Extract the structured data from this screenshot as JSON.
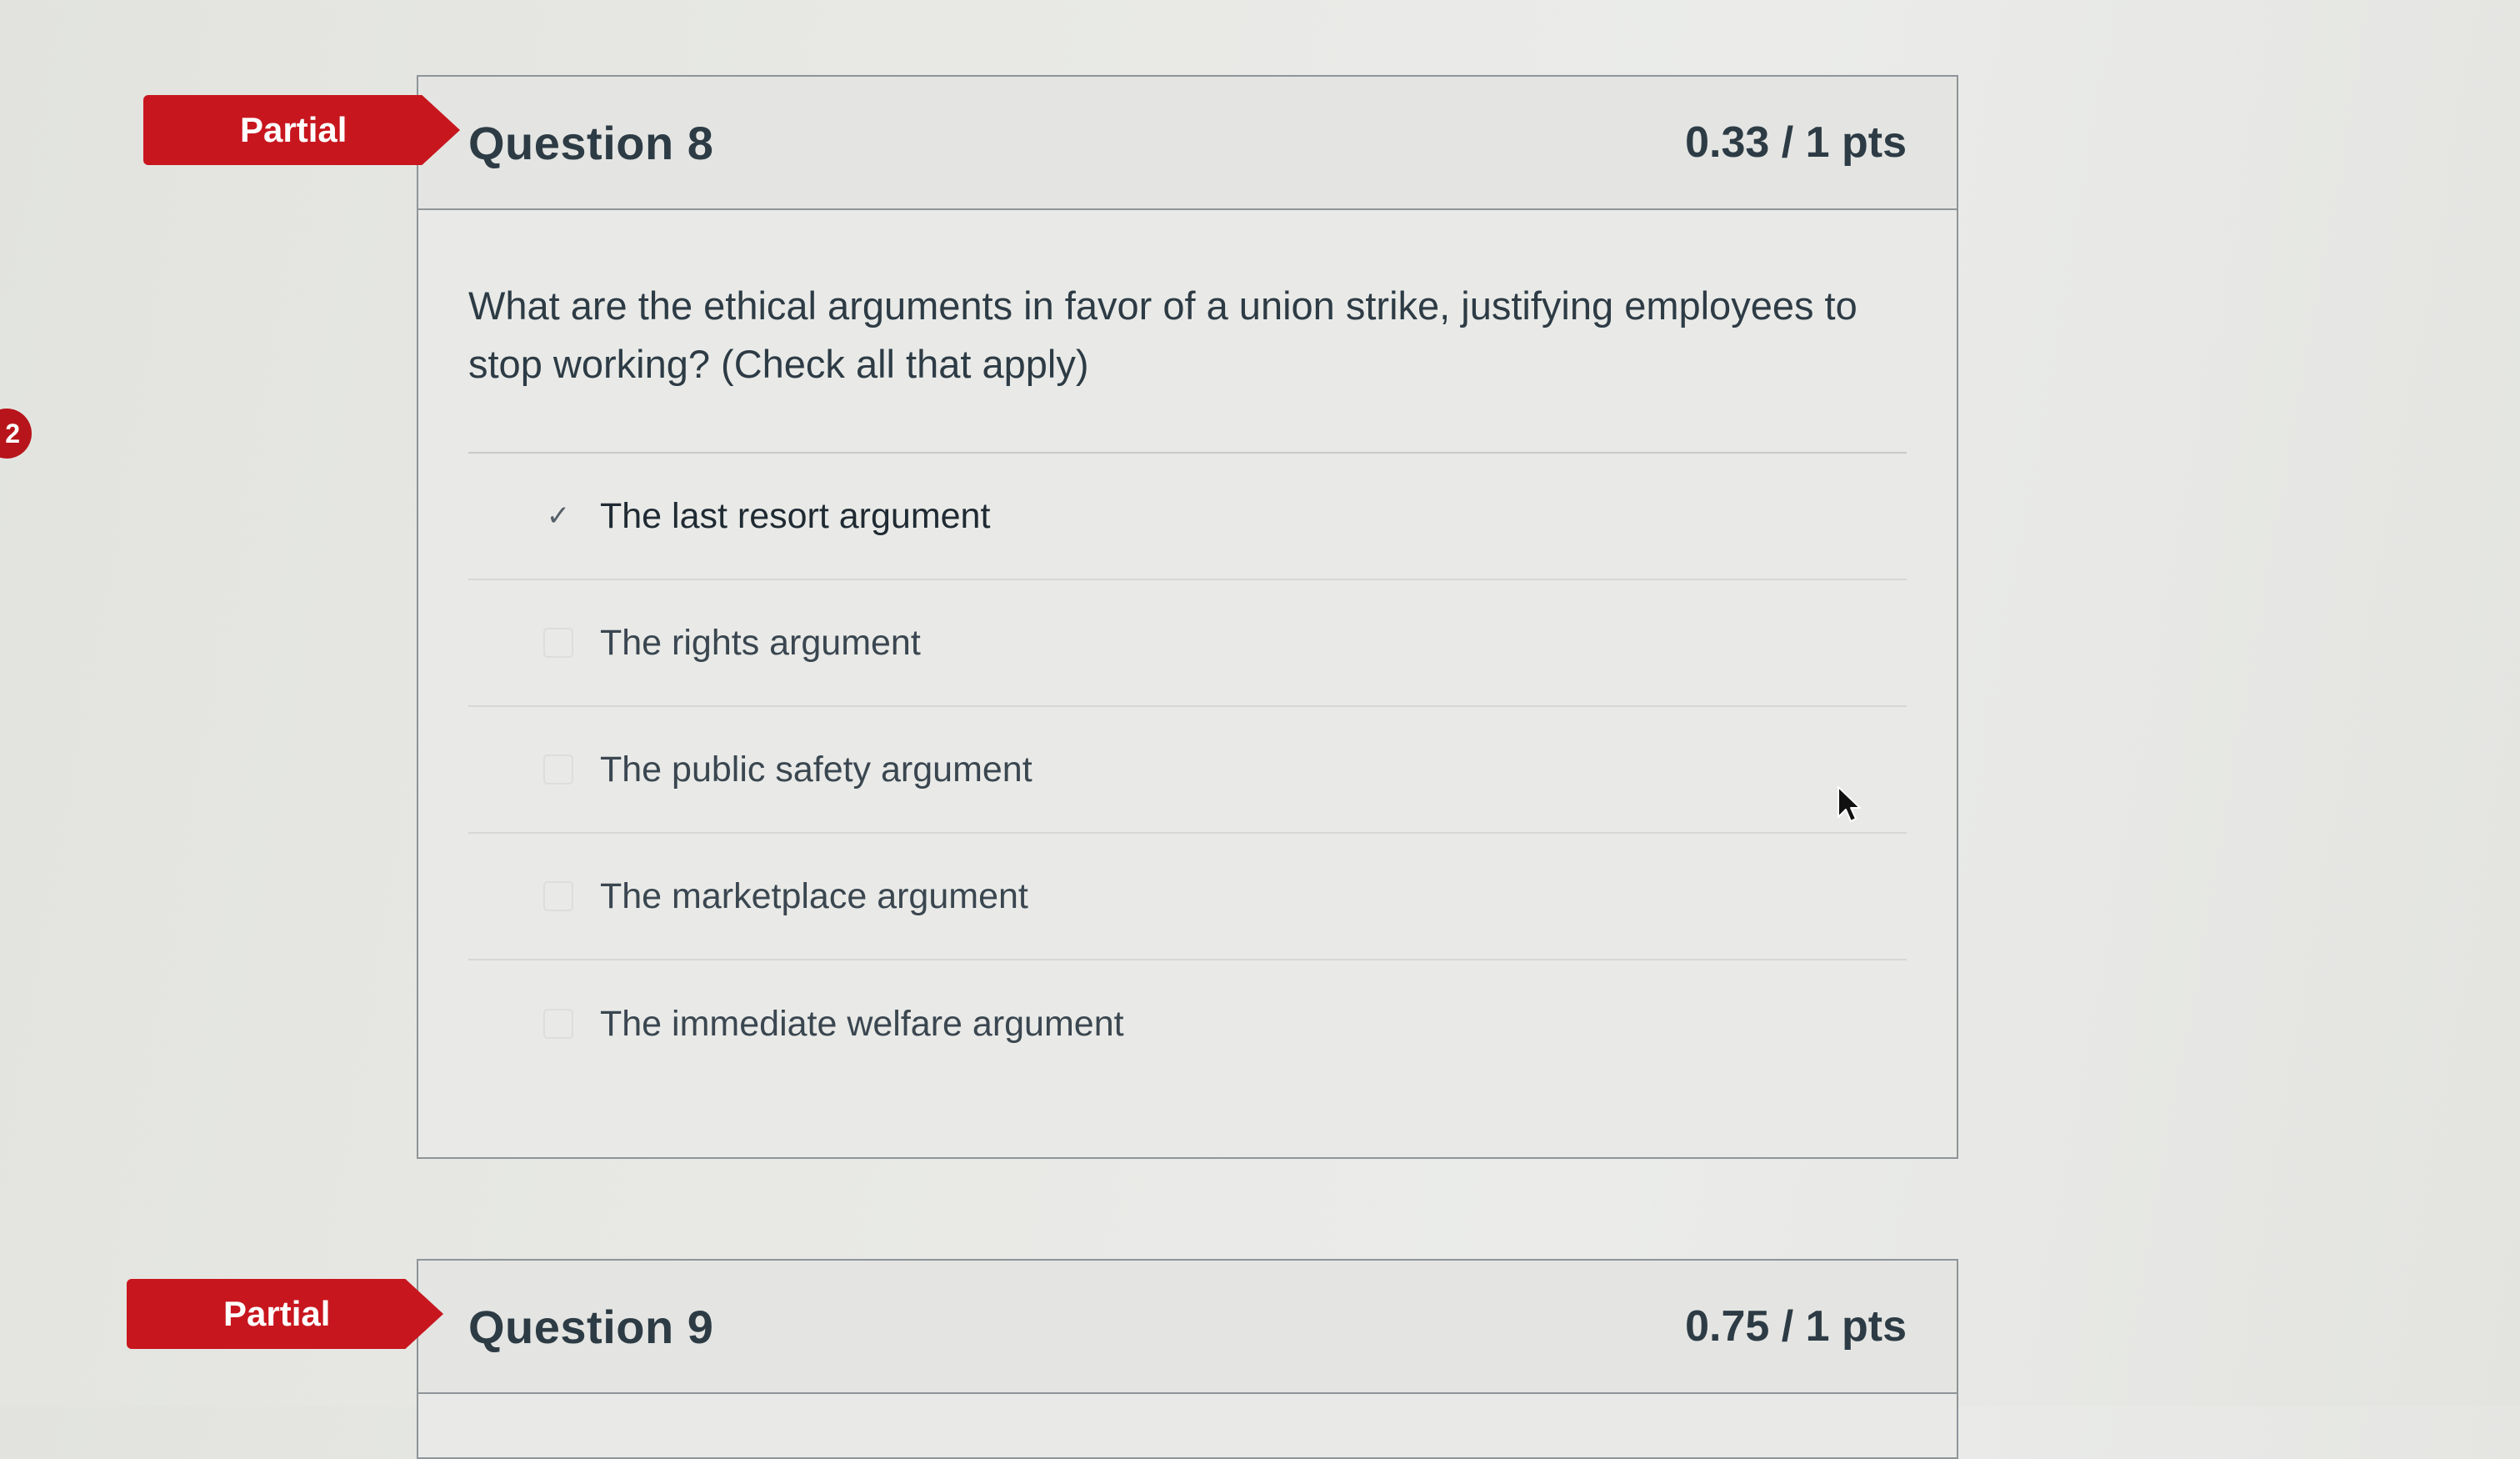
{
  "side_badge": {
    "count": "2"
  },
  "questions": [
    {
      "status": "Partial",
      "title": "Question 8",
      "points": "0.33 / 1 pts",
      "text": "What are the ethical arguments in favor of a union strike, justifying employees to stop working? (Check all that apply)",
      "answers": [
        {
          "label": "The last resort argument",
          "checked": true
        },
        {
          "label": "The rights argument",
          "checked": false
        },
        {
          "label": "The public safety argument",
          "checked": false
        },
        {
          "label": "The marketplace argument",
          "checked": false
        },
        {
          "label": "The immediate welfare argument",
          "checked": false
        }
      ]
    },
    {
      "status": "Partial",
      "title": "Question 9",
      "points": "0.75 / 1 pts"
    }
  ],
  "colors": {
    "status_partial": "#c8161e",
    "text": "#2d3b45",
    "border": "#8f9498"
  }
}
